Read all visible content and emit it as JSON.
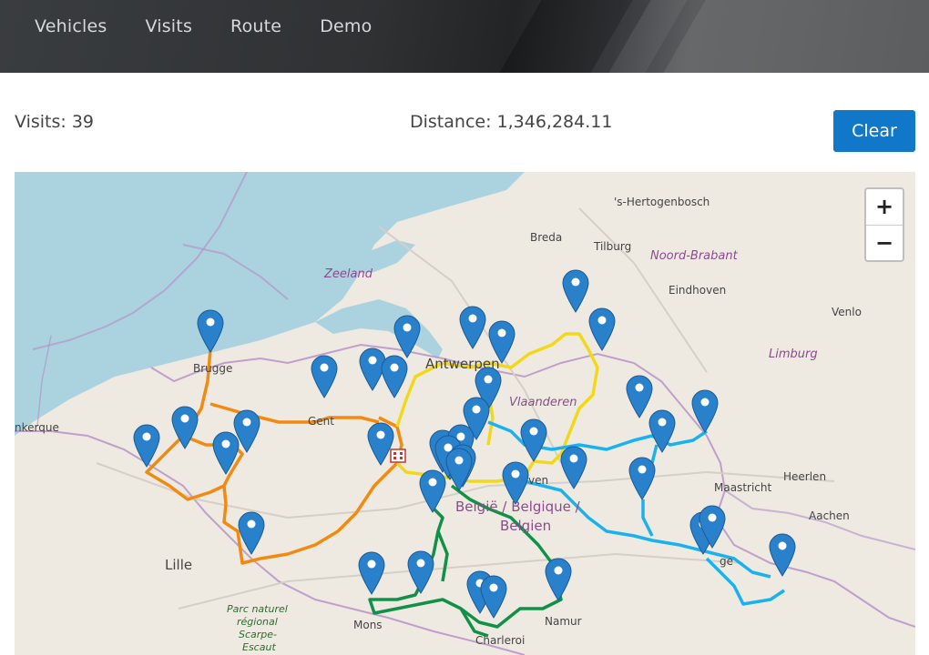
{
  "nav": {
    "items": [
      "Vehicles",
      "Visits",
      "Route",
      "Demo"
    ]
  },
  "summary": {
    "visits_text": "Visits: 39",
    "distance_text": "Distance: 1,346,284.11"
  },
  "actions": {
    "clear_label": "Clear"
  },
  "map": {
    "zoom_in": "+",
    "zoom_out": "−",
    "place_labels": {
      "hertogenbosch": "'s-Hertogenbosch",
      "breda": "Breda",
      "tilburg": "Tilburg",
      "noord_brabant": "Noord-Brabant",
      "zeeland": "Zeeland",
      "eindhoven": "Eindhoven",
      "venlo": "Venlo",
      "limburg": "Limburg",
      "antwerpen": "Antwerpen",
      "brugge": "Brugge",
      "gent": "Gent",
      "vlaanderen": "Vlaanderen",
      "dunkerque": "nkerque",
      "leuven": "ven",
      "maastricht": "Maastricht",
      "heerlen": "Heerlen",
      "belgique": "België / Belgique /",
      "belgien": "Belgien",
      "aachen": "Aachen",
      "lille": "Lille",
      "liege": "ge",
      "parc1": "Parc naturel",
      "parc2": "régional",
      "parc3": "Scarpe-",
      "parc4": "Escaut",
      "mons": "Mons",
      "namur": "Namur",
      "charleroi": "Charleroi"
    },
    "colors": {
      "orange_route": "#f28a12",
      "yellow_route": "#f2d81a",
      "blue_route": "#19b2ee",
      "green_route": "#119148",
      "marker": "#2a81cb",
      "sea": "#aad3df",
      "land": "#eeeae2"
    },
    "markers": [
      {
        "id": "m1"
      },
      {
        "id": "m2"
      },
      {
        "id": "m3"
      },
      {
        "id": "m4"
      },
      {
        "id": "m5"
      },
      {
        "id": "m6"
      },
      {
        "id": "m7"
      },
      {
        "id": "m8"
      },
      {
        "id": "m9"
      },
      {
        "id": "m10"
      },
      {
        "id": "m11"
      },
      {
        "id": "m12"
      },
      {
        "id": "m13"
      },
      {
        "id": "m14"
      },
      {
        "id": "m15"
      },
      {
        "id": "m16"
      },
      {
        "id": "m17"
      },
      {
        "id": "m18"
      },
      {
        "id": "m19"
      },
      {
        "id": "m20"
      },
      {
        "id": "m21"
      },
      {
        "id": "m22"
      },
      {
        "id": "m23"
      },
      {
        "id": "m24"
      },
      {
        "id": "m25"
      },
      {
        "id": "m26"
      },
      {
        "id": "m27"
      },
      {
        "id": "m28"
      },
      {
        "id": "m29"
      },
      {
        "id": "m30"
      },
      {
        "id": "m31"
      },
      {
        "id": "m32"
      },
      {
        "id": "m33"
      },
      {
        "id": "m34"
      },
      {
        "id": "m35"
      },
      {
        "id": "m36"
      },
      {
        "id": "m37"
      },
      {
        "id": "m38"
      },
      {
        "id": "m39"
      }
    ]
  }
}
